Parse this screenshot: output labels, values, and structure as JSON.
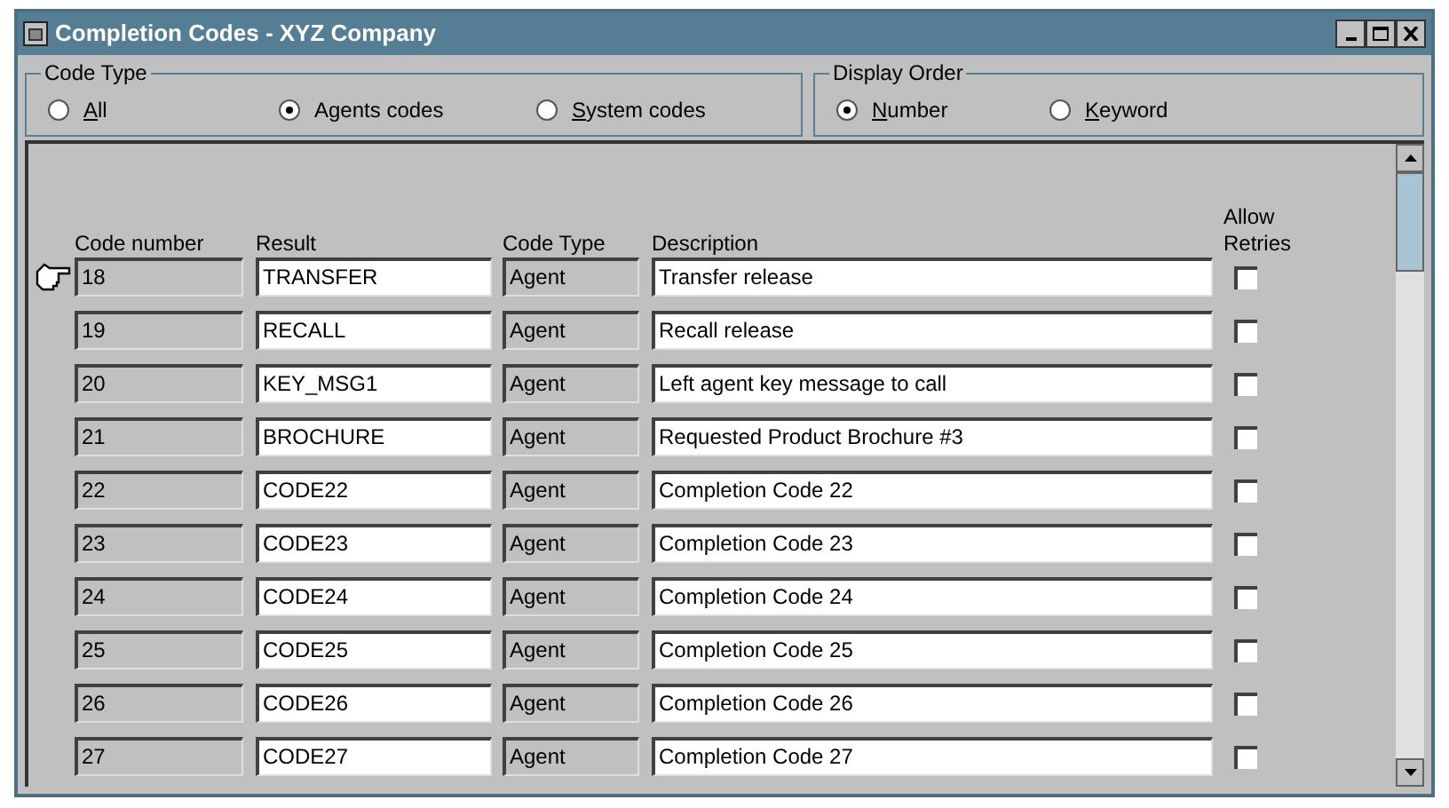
{
  "window": {
    "title": "Completion Codes - XYZ Company"
  },
  "code_type": {
    "label": "Code Type",
    "options": [
      {
        "label": "All",
        "selected": false
      },
      {
        "label": "Agents codes",
        "selected": true
      },
      {
        "label": "System codes",
        "selected": false
      }
    ]
  },
  "display_order": {
    "label": "Display Order",
    "options": [
      {
        "label": "Number",
        "selected": true
      },
      {
        "label": "Keyword",
        "selected": false
      }
    ]
  },
  "table": {
    "columns": [
      "Code number",
      "Result",
      "Code Type",
      "Description",
      "Allow Retries"
    ],
    "rows": [
      {
        "number": "18",
        "result": "TRANSFER",
        "type": "Agent",
        "description": "Transfer release",
        "allow_retries": false,
        "selected": true
      },
      {
        "number": "19",
        "result": "RECALL",
        "type": "Agent",
        "description": "Recall release",
        "allow_retries": false,
        "selected": false
      },
      {
        "number": "20",
        "result": "KEY_MSG1",
        "type": "Agent",
        "description": "Left agent key message to call",
        "allow_retries": false,
        "selected": false
      },
      {
        "number": "21",
        "result": "BROCHURE",
        "type": "Agent",
        "description": "Requested Product Brochure #3",
        "allow_retries": false,
        "selected": false
      },
      {
        "number": "22",
        "result": "CODE22",
        "type": "Agent",
        "description": "Completion Code 22",
        "allow_retries": false,
        "selected": false
      },
      {
        "number": "23",
        "result": "CODE23",
        "type": "Agent",
        "description": "Completion Code 23",
        "allow_retries": false,
        "selected": false
      },
      {
        "number": "24",
        "result": "CODE24",
        "type": "Agent",
        "description": "Completion Code 24",
        "allow_retries": false,
        "selected": false
      },
      {
        "number": "25",
        "result": "CODE25",
        "type": "Agent",
        "description": "Completion Code 25",
        "allow_retries": false,
        "selected": false
      },
      {
        "number": "26",
        "result": "CODE26",
        "type": "Agent",
        "description": "Completion Code 26",
        "allow_retries": false,
        "selected": false
      },
      {
        "number": "27",
        "result": "CODE27",
        "type": "Agent",
        "description": "Completion Code 27",
        "allow_retries": false,
        "selected": false
      }
    ]
  }
}
